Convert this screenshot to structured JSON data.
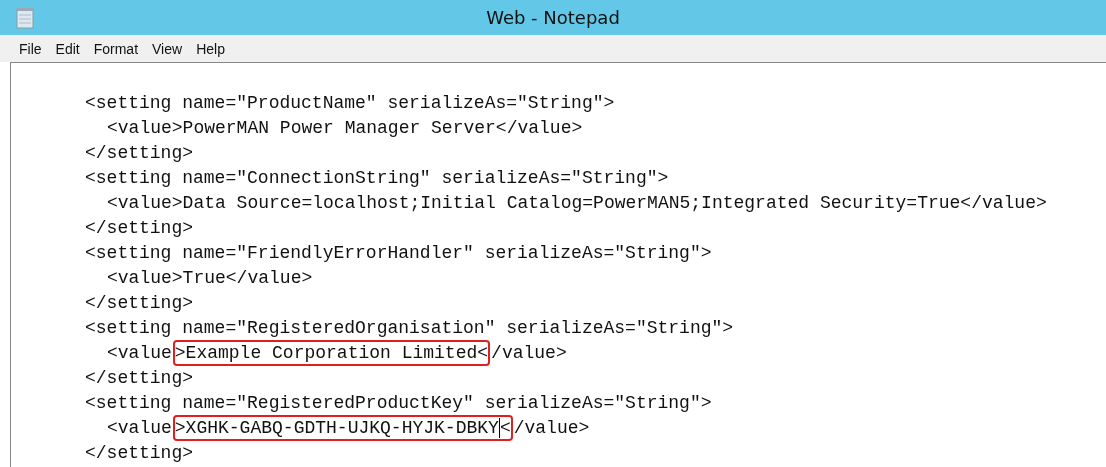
{
  "window": {
    "title": "Web - Notepad"
  },
  "menu": [
    "File",
    "Edit",
    "Format",
    "View",
    "Help"
  ],
  "settings": [
    {
      "open_tag": "<setting name=\"ProductName\" serializeAs=\"String\">",
      "value_parts": [
        {
          "text": "<value>PowerMAN Power Manager Server</value>",
          "highlighted": false
        }
      ],
      "close_tag": "</setting>"
    },
    {
      "open_tag": "<setting name=\"ConnectionString\" serializeAs=\"String\">",
      "value_parts": [
        {
          "text": "<value>Data Source=localhost;Initial Catalog=PowerMAN5;Integrated Security=True</value>",
          "highlighted": false
        }
      ],
      "close_tag": "</setting>"
    },
    {
      "open_tag": "<setting name=\"FriendlyErrorHandler\" serializeAs=\"String\">",
      "value_parts": [
        {
          "text": "<value>True</value>",
          "highlighted": false
        }
      ],
      "close_tag": "</setting>"
    },
    {
      "open_tag": "<setting name=\"RegisteredOrganisation\" serializeAs=\"String\">",
      "value_parts": [
        {
          "text": "<value",
          "highlighted": false
        },
        {
          "text": ">Example Corporation Limited<",
          "highlighted": true
        },
        {
          "text": "/value>",
          "highlighted": false
        }
      ],
      "close_tag": "</setting>"
    },
    {
      "open_tag": "<setting name=\"RegisteredProductKey\" serializeAs=\"String\">",
      "value_parts": [
        {
          "text": "<value",
          "highlighted": false
        },
        {
          "text": ">XGHK-GABQ-GDTH-UJKQ-HYJK-DBKY<",
          "highlighted": true,
          "caret": true
        },
        {
          "text": "/value>",
          "highlighted": false
        }
      ],
      "close_tag": "</setting>"
    }
  ]
}
